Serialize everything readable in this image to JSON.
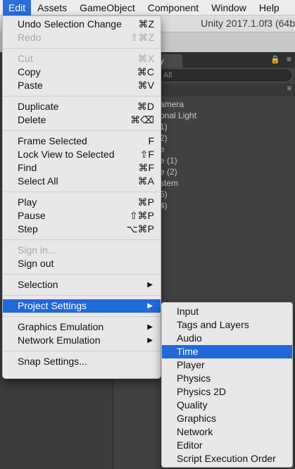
{
  "menubar": {
    "items": [
      "Edit",
      "Assets",
      "GameObject",
      "Component",
      "Window",
      "Help"
    ],
    "active": "Edit"
  },
  "editor": {
    "title": "Unity 2017.1.0f3 (64b",
    "hierarchy": {
      "search_placeholder": "All",
      "items": [
        "amera",
        "onal Light",
        "1)",
        "2)",
        "e",
        "e (1)",
        "e (2)",
        "stem",
        "5)",
        "4)"
      ]
    }
  },
  "edit_menu": {
    "groups": [
      [
        {
          "label": "Undo Selection Change",
          "shortcut": "⌘Z",
          "enabled": true
        },
        {
          "label": "Redo",
          "shortcut": "⇧⌘Z",
          "enabled": false
        }
      ],
      [
        {
          "label": "Cut",
          "shortcut": "⌘X",
          "enabled": false
        },
        {
          "label": "Copy",
          "shortcut": "⌘C",
          "enabled": true
        },
        {
          "label": "Paste",
          "shortcut": "⌘V",
          "enabled": true
        }
      ],
      [
        {
          "label": "Duplicate",
          "shortcut": "⌘D",
          "enabled": true
        },
        {
          "label": "Delete",
          "shortcut": "⌘⌫",
          "enabled": true
        }
      ],
      [
        {
          "label": "Frame Selected",
          "shortcut": "F",
          "enabled": true
        },
        {
          "label": "Lock View to Selected",
          "shortcut": "⇧F",
          "enabled": true
        },
        {
          "label": "Find",
          "shortcut": "⌘F",
          "enabled": true
        },
        {
          "label": "Select All",
          "shortcut": "⌘A",
          "enabled": true
        }
      ],
      [
        {
          "label": "Play",
          "shortcut": "⌘P",
          "enabled": true
        },
        {
          "label": "Pause",
          "shortcut": "⇧⌘P",
          "enabled": true
        },
        {
          "label": "Step",
          "shortcut": "⌥⌘P",
          "enabled": true
        }
      ],
      [
        {
          "label": "Sign in...",
          "shortcut": "",
          "enabled": false
        },
        {
          "label": "Sign out",
          "shortcut": "",
          "enabled": true
        }
      ],
      [
        {
          "label": "Selection",
          "submenu": true,
          "enabled": true
        }
      ],
      [
        {
          "label": "Project Settings",
          "submenu": true,
          "enabled": true,
          "highlighted": true
        }
      ],
      [
        {
          "label": "Graphics Emulation",
          "submenu": true,
          "enabled": true
        },
        {
          "label": "Network Emulation",
          "submenu": true,
          "enabled": true
        }
      ],
      [
        {
          "label": "Snap Settings...",
          "shortcut": "",
          "enabled": true
        }
      ]
    ]
  },
  "project_settings_submenu": {
    "items": [
      "Input",
      "Tags and Layers",
      "Audio",
      "Time",
      "Player",
      "Physics",
      "Physics 2D",
      "Quality",
      "Graphics",
      "Network",
      "Editor",
      "Script Execution Order"
    ],
    "highlighted": "Time"
  },
  "colors": {
    "highlight": "#1f69db",
    "menu_bg": "#e8e8e8",
    "disabled_text": "#a8a8a8"
  }
}
